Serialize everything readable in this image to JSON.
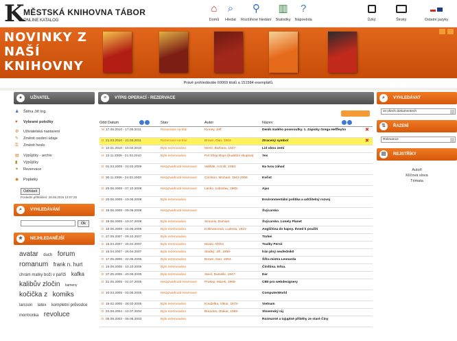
{
  "header": {
    "logo_letter": "K",
    "title": "MĚSTSKÁ KNIHOVNA TÁBOR",
    "subtitle": "ONLINE KATALOG",
    "nav": [
      {
        "label": "Domů",
        "icon": "house-icon"
      },
      {
        "label": "Hledat",
        "icon": "magnifier-icon"
      },
      {
        "label": "Rozšířené hledání",
        "icon": "advanced-search-icon"
      },
      {
        "label": "Statistiky",
        "icon": "chart-icon"
      },
      {
        "label": "Nápověda",
        "icon": "help-icon"
      }
    ],
    "nav2": [
      {
        "label": "Úzký",
        "icon": "monitor-narrow-icon"
      },
      {
        "label": "Široký",
        "icon": "monitor-wide-icon"
      },
      {
        "label": "Ostatní jazyky",
        "icon": "flags-icon"
      }
    ]
  },
  "banner": {
    "title": "NOVINKY Z NAŠÍ KNIHOVNY",
    "books": [
      {
        "color": "#b21d14",
        "accent": "#f2c24a"
      },
      {
        "color": "#7c1e14",
        "accent": "#e0b044"
      },
      {
        "color": "#a2281a",
        "accent": "#6c1a12"
      },
      {
        "color": "#e56a1a",
        "accent": "#f6d29a"
      },
      {
        "color": "#c22a1c",
        "accent": "#2b2b2b"
      }
    ]
  },
  "info": {
    "text": "Právě prohledáváte 69069 titulů a 151584 exemplářů."
  },
  "left": {
    "user_heading": "UŽIVATEL",
    "user_name": "Štěha Jiří Ing.",
    "favorites": "Vybrané položky",
    "items": [
      {
        "label": "Uživatelská nastavení",
        "icon": "settings-icon"
      },
      {
        "label": "Změnit osobní údaje",
        "icon": "edit-icon"
      },
      {
        "label": "Změnit heslo",
        "icon": "key-icon"
      },
      {
        "label": "Výpůjčky - archiv",
        "icon": "archive-icon"
      },
      {
        "label": "Výpůjčky",
        "icon": "book-icon"
      },
      {
        "label": "Rezervace",
        "icon": "reservation-icon"
      },
      {
        "label": "Poplatky",
        "icon": "coins-icon"
      }
    ],
    "logout": "Odhlásit",
    "last_login": "Poslední přihlášení: 26.05.2016 13:07:25",
    "search_heading": "VYHLEDÁVÁNÍ",
    "search_button": "Ok",
    "tags_heading": "NEJHLEDANĚJŠÍ",
    "tags": [
      {
        "text": "avatar",
        "size": 10
      },
      {
        "text": "duch",
        "size": 6
      },
      {
        "text": "forum",
        "size": 10
      },
      {
        "text": "romanum",
        "size": 10
      },
      {
        "text": "frank n. hurt",
        "size": 8
      },
      {
        "text": "chrám matky boží v paříži",
        "size": 6
      },
      {
        "text": "kafka",
        "size": 8
      },
      {
        "text": "kalibův zločin",
        "size": 10
      },
      {
        "text": "kameny",
        "size": 5
      },
      {
        "text": "kočička z",
        "size": 10
      },
      {
        "text": "komiks",
        "size": 10
      },
      {
        "text": "larsson",
        "size": 6
      },
      {
        "text": "latex",
        "size": 6
      },
      {
        "text": "kompletní průvodce",
        "size": 6
      },
      {
        "text": "mormonka",
        "size": 6
      },
      {
        "text": "revoluce",
        "size": 10
      }
    ]
  },
  "center": {
    "heading": "VÝPIS OPERACÍ - REZERVACE",
    "columns": {
      "date": "Odd Datum",
      "state": "Stav",
      "author": "Autor",
      "title": "Název"
    },
    "rows": [
      {
        "mark": "M",
        "date": "17.05.2010 - 17.05.2011",
        "state": "Rezervace na titul",
        "author": "Kinney, Jeff",
        "title": "Deník malého poseroutky. 1. Zápisky Grega Heffleyho",
        "hl": false,
        "tall": true,
        "del": true
      },
      {
        "mark": "D",
        "date": "21.03.2010 - 21.03.2011",
        "state": "Rezervace na titul",
        "author": "Brown, Dan, 1964-",
        "title": "Ztracený symbol",
        "hl": true,
        "tall": false,
        "del": true
      },
      {
        "mark": "D",
        "date": "10.01.2010 - 10.02.2010",
        "state": "Bylo rezervováno",
        "author": "Mertz, Barbara, 1927-",
        "title": "Lid obou zemí",
        "hl": false,
        "tall": false,
        "del": false
      },
      {
        "mark": "H",
        "date": "12.11.2009 - 21.04.2010",
        "state": "Bylo rezervováno",
        "author": "Pet Shop Boys (hudební skupina)",
        "title": "Yes",
        "hl": false,
        "tall": true,
        "del": false
      },
      {
        "mark": "D",
        "date": "01.03.2009 - 24.03.2009",
        "state": "Nevyzvednutá rezervace",
        "author": "Vaššák, Arnošt, 1953-",
        "title": "Na tvou záhad",
        "hl": false,
        "tall": true,
        "del": false
      },
      {
        "mark": "D",
        "date": "30.11.2008 - 24.03.2009",
        "state": "Nevyzvednutá rezervace",
        "author": "Crichton, Michael, 1942-2008",
        "title": "Kořist",
        "hl": false,
        "tall": true,
        "del": false
      },
      {
        "mark": "D",
        "date": "25.06.2008 - 07.10.2008",
        "state": "Nevyzvednutá rezervace",
        "author": "Lacko, Ľuboslav, 1965-",
        "title": "Ajax",
        "hl": false,
        "tall": true,
        "del": false
      },
      {
        "mark": "D",
        "date": "20.06.2008 - 19.06.2008",
        "state": "Bylo rezervováno",
        "author": "",
        "title": "Environmentální politika a udržitelný rozvoj",
        "hl": false,
        "tall": true,
        "del": false
      },
      {
        "mark": "D",
        "date": "19.06.2008 - 09.09.2008",
        "state": "Nevyzvednutá rezervace",
        "author": "",
        "title": "Švýcarsko",
        "hl": false,
        "tall": true,
        "del": false
      },
      {
        "mark": "D",
        "date": "19.06.2008 - 19.07.2008",
        "state": "Bylo rezervováno",
        "author": "Simonis, Damian",
        "title": "Švýcarsko. Lonely Planet",
        "hl": false,
        "tall": false,
        "del": false
      },
      {
        "mark": "D",
        "date": "16.06.2008 - 15.06.2008",
        "state": "Bylo rezervováno",
        "author": "Kollmannová, Ludmila, 1921-",
        "title": "Angličtina do kapsy. Ihned k použití",
        "hl": false,
        "tall": false,
        "del": false
      },
      {
        "mark": "D",
        "date": "27.09.2007 - 09.10.2007",
        "state": "Bylo rezervováno",
        "author": "",
        "title": "Türkei",
        "hl": false,
        "tall": false,
        "del": false
      },
      {
        "mark": "D",
        "date": "15.04.2007 - 25.04.2007",
        "state": "Bylo rezervováno",
        "author": "Moiav, Afshin",
        "title": "Toulky Persií",
        "hl": false,
        "tall": false,
        "del": false
      },
      {
        "mark": "D",
        "date": "15.04.2007 - 26.04.2007",
        "state": "Bylo rezervováno",
        "author": "Sladký, Jiří, 1950-",
        "title": "Írán plný neafednik0",
        "hl": false,
        "tall": false,
        "del": false
      },
      {
        "mark": "D",
        "date": "17.05.2006 - 22.05.2006",
        "state": "Bylo rezervováno",
        "author": "Brown, Dan, 1964-",
        "title": "Šifra mistra Leonarda",
        "hl": false,
        "tall": false,
        "del": false
      },
      {
        "mark": "D",
        "date": "16.09.2005 - 10.10.2005",
        "state": "Bylo rezervováno",
        "author": "",
        "title": "Čínština. Infoa.",
        "hl": false,
        "tall": false,
        "del": false
      },
      {
        "mark": "D",
        "date": "27.05.2005 - 20.06.2005",
        "state": "Bylo rezervováno",
        "author": "Steel, Danielle, 1947-",
        "title": "Dar",
        "hl": false,
        "tall": false,
        "del": false
      },
      {
        "mark": "D",
        "date": "21.05.2005 - 01.07.2005",
        "state": "Nevyzvednutá rezervace",
        "author": "Prokop, Marek, 1965-",
        "title": "CBII pro webdesignery",
        "hl": false,
        "tall": true,
        "del": false
      },
      {
        "mark": "D",
        "date": "10.03.2005 - 03.05.2005",
        "state": "Nevyzvednutá rezervace",
        "author": "",
        "title": "ComputerWorld",
        "hl": false,
        "tall": true,
        "del": false
      },
      {
        "mark": "D",
        "date": "16.02.2005 - 28.02.2005",
        "state": "Bylo rezervováno",
        "author": "Koudelka, Viktor, 1973-",
        "title": "Vietnam",
        "hl": false,
        "tall": false,
        "del": false
      },
      {
        "mark": "D",
        "date": "24.08.2004 - 12.07.2004",
        "state": "Bylo rezervováno",
        "author": "Brandos, Otakar, 1969-",
        "title": "Slovenský ráj",
        "hl": false,
        "tall": false,
        "del": false
      },
      {
        "mark": "D",
        "date": "05.08.2003 - 08.08.2003",
        "state": "Bylo rezervováno",
        "author": "",
        "title": "Rozmarné a tajuplné příběhy ze staré Číny",
        "hl": false,
        "tall": true,
        "del": false
      }
    ]
  },
  "right": {
    "search_heading": "VYHLEDÁVAT",
    "search_scope": "ve všech dokumentech",
    "sort_heading": "ŘAZENÍ",
    "sort_value": "Relevance",
    "reg_heading": "REJSTŘÍKY",
    "regs": [
      "Autoři",
      "Klíčová slova",
      "Témata"
    ]
  },
  "colors": {
    "orange": "#e06a13",
    "highlight": "#fff35c",
    "banner": "#d95a12"
  }
}
